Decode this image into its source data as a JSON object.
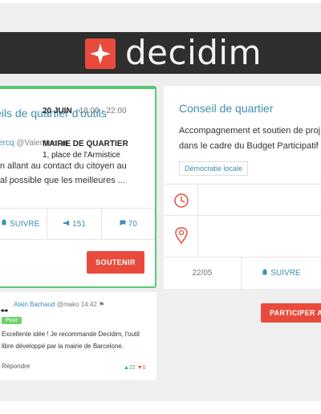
{
  "brand": {
    "name": "decidim",
    "accent": "#e84b3c",
    "link_color": "#3e8fb0",
    "positive": "#5bc779"
  },
  "proposal": {
    "title": "eils de quartier d'outils",
    "author": "ercq",
    "handle": "@Valentine",
    "body_lines": [
      "n allant au contact du citoyen au",
      "al possible que les meilleures ..."
    ],
    "follow_label": "SUIVRE",
    "endorsements": "151",
    "comments": "70",
    "support_label": "SOUTENIR"
  },
  "comment": {
    "author": "Alain Bachaud",
    "handle": "@mako",
    "time": "14:42",
    "badge": "Pour",
    "body_lines": [
      "Excellente idée ! Je recommande Decidim, l'outil",
      "libre développé par la mairie de Barcelone."
    ],
    "reply_label": "Répondre",
    "upvotes": "22",
    "downvotes": "0"
  },
  "meeting": {
    "title": "Conseil de quartier",
    "desc_lines": [
      "Accompagnement et soutien de proj",
      "dans le cadre du Budget Participatif"
    ],
    "tag": "Démocratie locale",
    "date": "20 JUIN",
    "time": "· 18:00 - 22:00",
    "place_name": "MAIRIE DE QUARTIER",
    "place_address": "1, place de l'Armistice",
    "footer_date": "22/05",
    "follow_label": "SUIVRE",
    "participate_label": "PARTICIPER A"
  }
}
